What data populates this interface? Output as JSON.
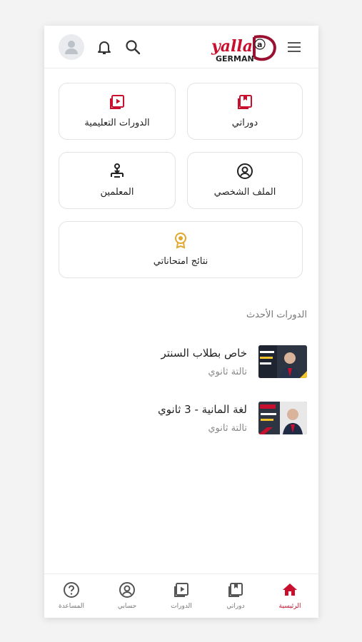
{
  "header": {
    "logo_text_top": "yalla",
    "logo_text_bottom": "GERMAN",
    "icons": [
      "menu-icon",
      "search-icon",
      "bell-icon",
      "avatar-icon"
    ]
  },
  "menu_cards": [
    {
      "label": "دوراتي",
      "icon": "bookmark-icon"
    },
    {
      "label": "الدورات التعليمية",
      "icon": "video-library-icon"
    },
    {
      "label": "الملف الشخصي",
      "icon": "profile-icon"
    },
    {
      "label": "المعلمين",
      "icon": "teacher-icon"
    },
    {
      "label": "نتائج امتحاناتي",
      "icon": "award-icon"
    }
  ],
  "latest": {
    "title": "الدورات الأحدث",
    "courses": [
      {
        "title": "خاص بطلاب السنتر",
        "subtitle": "تالتة ثانوي"
      },
      {
        "title": "لغة المانية - 3 ثانوي",
        "subtitle": "تالتة ثانوي"
      }
    ]
  },
  "bottom_nav": [
    {
      "label": "الرئيسية",
      "icon": "home-icon",
      "active": true
    },
    {
      "label": "دوراتي",
      "icon": "bookmark-icon",
      "active": false
    },
    {
      "label": "الدورات",
      "icon": "video-library-icon",
      "active": false
    },
    {
      "label": "حسابي",
      "icon": "account-icon",
      "active": false
    },
    {
      "label": "المساعدة",
      "icon": "help-icon",
      "active": false
    }
  ],
  "colors": {
    "accent": "#c8102e",
    "gold": "#e0a82e",
    "text": "#222222",
    "muted": "#888888"
  }
}
